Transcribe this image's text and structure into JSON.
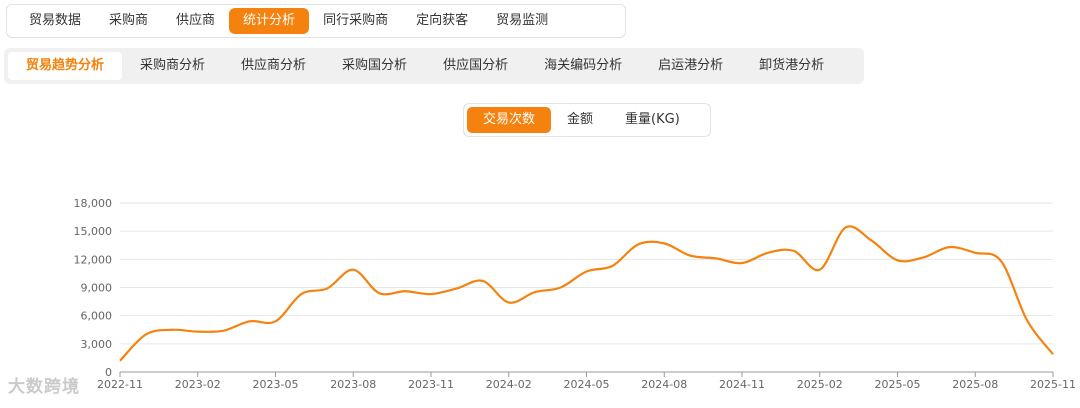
{
  "top_tabs": [
    "贸易数据",
    "采购商",
    "供应商",
    "统计分析",
    "同行采购商",
    "定向获客",
    "贸易监测"
  ],
  "top_active": 3,
  "sub_tabs": [
    "贸易趋势分析",
    "采购商分析",
    "供应商分析",
    "采购国分析",
    "供应国分析",
    "海关编码分析",
    "启运港分析",
    "卸货港分析"
  ],
  "sub_active": 0,
  "metric_tabs": [
    "交易次数",
    "金额",
    "重量(KG)"
  ],
  "metric_active": 0,
  "watermark": "大数跨境",
  "colors": {
    "accent": "#f5820f",
    "line": "#f5820f",
    "grid": "#e6e6e6"
  },
  "chart_data": {
    "type": "line",
    "ylim": [
      0,
      18000
    ],
    "yticks": [
      "18,000",
      "15,000",
      "12,000",
      "9,000",
      "6,000",
      "3,000",
      "0"
    ],
    "ytick_values": [
      18000,
      15000,
      12000,
      9000,
      6000,
      3000,
      0
    ],
    "xtick_labels": [
      "2022-11",
      "2023-02",
      "2023-05",
      "2023-08",
      "2023-11",
      "2024-02",
      "2024-05",
      "2024-08",
      "2024-11",
      "2025-02",
      "2025-05",
      "2025-08",
      "2025-11"
    ],
    "grid": true,
    "x": [
      "2022-11",
      "2022-12",
      "2023-01",
      "2023-02",
      "2023-03",
      "2023-04",
      "2023-05",
      "2023-06",
      "2023-07",
      "2023-08",
      "2023-09",
      "2023-10",
      "2023-11",
      "2023-12",
      "2024-01",
      "2024-02",
      "2024-03",
      "2024-04",
      "2024-05",
      "2024-06",
      "2024-07",
      "2024-08",
      "2024-09",
      "2024-10",
      "2024-11",
      "2024-12",
      "2025-01",
      "2025-02",
      "2025-03",
      "2025-04",
      "2025-05",
      "2025-06",
      "2025-07",
      "2025-08",
      "2025-09",
      "2025-10",
      "2025-11"
    ],
    "values": [
      1200,
      4000,
      4500,
      4300,
      4400,
      5400,
      5400,
      8300,
      8900,
      10900,
      8400,
      8600,
      8300,
      8900,
      9700,
      7400,
      8500,
      9000,
      10700,
      11300,
      13600,
      13700,
      12400,
      12100,
      11600,
      12700,
      12900,
      10900,
      15400,
      14000,
      11900,
      12200,
      13300,
      12700,
      11800,
      5500,
      1900
    ]
  }
}
